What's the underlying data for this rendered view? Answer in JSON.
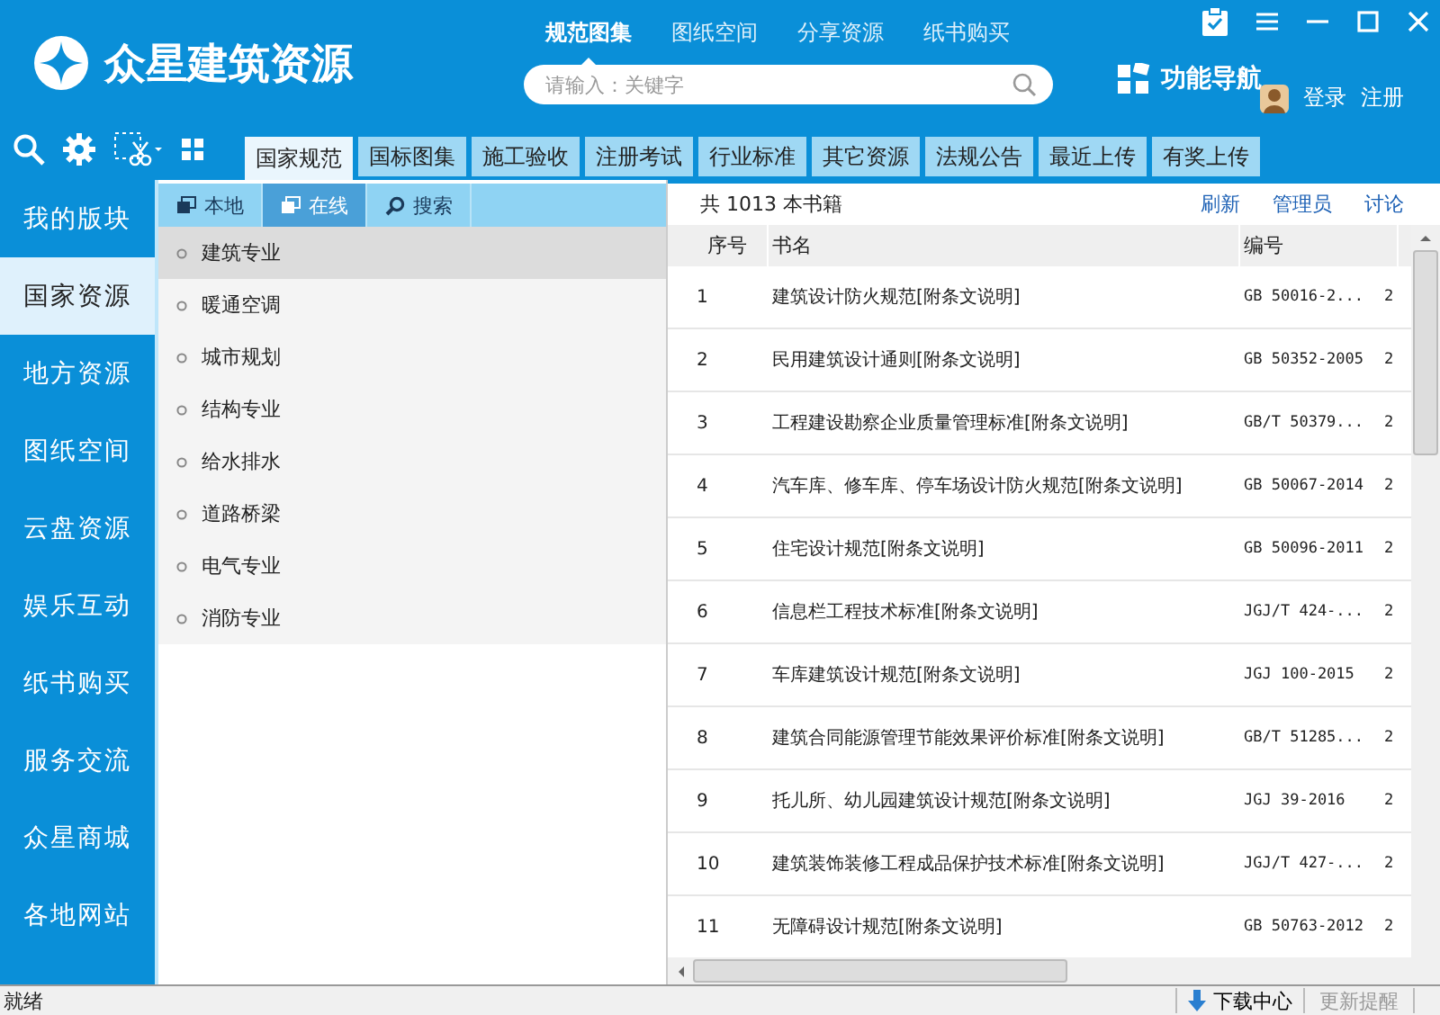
{
  "app": {
    "title": "众星建筑资源"
  },
  "top_nav": [
    {
      "label": "规范图集",
      "selected": true
    },
    {
      "label": "图纸空间",
      "selected": false
    },
    {
      "label": "分享资源",
      "selected": false
    },
    {
      "label": "纸书购买",
      "selected": false
    }
  ],
  "search": {
    "placeholder": "请输入：关键字"
  },
  "feature_nav": {
    "label": "功能导航"
  },
  "user": {
    "login": "登录",
    "register": "注册"
  },
  "category_tabs": [
    {
      "label": "国家规范",
      "selected": true
    },
    {
      "label": "国标图集",
      "selected": false
    },
    {
      "label": "施工验收",
      "selected": false
    },
    {
      "label": "注册考试",
      "selected": false
    },
    {
      "label": "行业标准",
      "selected": false
    },
    {
      "label": "其它资源",
      "selected": false
    },
    {
      "label": "法规公告",
      "selected": false
    },
    {
      "label": "最近上传",
      "selected": false
    },
    {
      "label": "有奖上传",
      "selected": false
    }
  ],
  "sidebar": {
    "items": [
      {
        "label": "我的版块",
        "selected": false
      },
      {
        "label": "国家资源",
        "selected": true
      },
      {
        "label": "地方资源",
        "selected": false
      },
      {
        "label": "图纸空间",
        "selected": false
      },
      {
        "label": "云盘资源",
        "selected": false
      },
      {
        "label": "娱乐互动",
        "selected": false
      },
      {
        "label": "纸书购买",
        "selected": false
      },
      {
        "label": "服务交流",
        "selected": false
      },
      {
        "label": "众星商城",
        "selected": false
      },
      {
        "label": "各地网站",
        "selected": false
      }
    ]
  },
  "source_tabs": [
    {
      "label": "本地",
      "selected": false,
      "kind": "window"
    },
    {
      "label": "在线",
      "selected": true,
      "kind": "window"
    },
    {
      "label": "搜索",
      "selected": false,
      "kind": "search"
    }
  ],
  "categories": [
    {
      "label": "建筑专业",
      "selected": true
    },
    {
      "label": "暖通空调",
      "selected": false
    },
    {
      "label": "城市规划",
      "selected": false
    },
    {
      "label": "结构专业",
      "selected": false
    },
    {
      "label": "给水排水",
      "selected": false
    },
    {
      "label": "道路桥梁",
      "selected": false
    },
    {
      "label": "电气专业",
      "selected": false
    },
    {
      "label": "消防专业",
      "selected": false
    }
  ],
  "book_count": "共 1013 本书籍",
  "actions": [
    "刷新",
    "管理员",
    "讨论"
  ],
  "table": {
    "columns": [
      "序号",
      "书名",
      "编号"
    ],
    "rows": [
      [
        "1",
        "建筑设计防火规范[附条文说明]",
        "GB 50016-2...",
        "2"
      ],
      [
        "2",
        "民用建筑设计通则[附条文说明]",
        "GB 50352-2005",
        "2"
      ],
      [
        "3",
        "工程建设勘察企业质量管理标准[附条文说明]",
        "GB/T 50379...",
        "2"
      ],
      [
        "4",
        "汽车库、修车库、停车场设计防火规范[附条文说明]",
        "GB 50067-2014",
        "2"
      ],
      [
        "5",
        "住宅设计规范[附条文说明]",
        "GB 50096-2011",
        "2"
      ],
      [
        "6",
        "信息栏工程技术标准[附条文说明]",
        "JGJ/T 424-...",
        "2"
      ],
      [
        "7",
        "车库建筑设计规范[附条文说明]",
        "JGJ 100-2015",
        "2"
      ],
      [
        "8",
        "建筑合同能源管理节能效果评价标准[附条文说明]",
        "GB/T 51285...",
        "2"
      ],
      [
        "9",
        "托儿所、幼儿园建筑设计规范[附条文说明]",
        "JGJ 39-2016",
        "2"
      ],
      [
        "10",
        "建筑装饰装修工程成品保护技术标准[附条文说明]",
        "JGJ/T 427-...",
        "2"
      ],
      [
        "11",
        "无障碍设计规范[附条文说明]",
        "GB 50763-2012",
        "2"
      ]
    ]
  },
  "status_bar": {
    "text": "就绪",
    "download": "下载中心",
    "update": "更新提醒"
  }
}
